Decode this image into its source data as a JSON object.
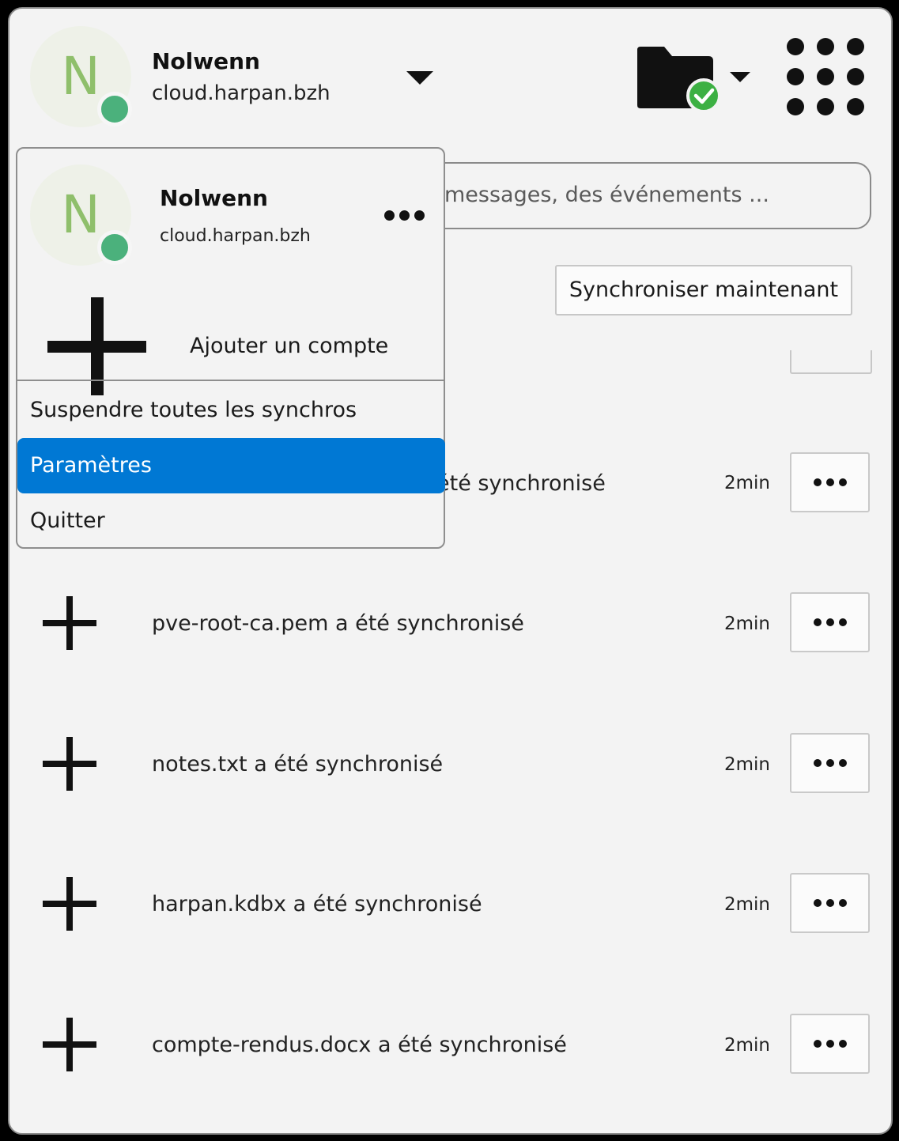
{
  "account": {
    "initial": "N",
    "name": "Nolwenn",
    "server": "cloud.harpan.bzh"
  },
  "search": {
    "placeholder": "messages, des événements ..."
  },
  "sync_button": "Synchroniser maintenant",
  "popup": {
    "account_name": "Nolwenn",
    "account_server": "cloud.harpan.bzh",
    "add_account": "Ajouter un compte",
    "menu": [
      "Suspendre toutes les synchros",
      "Paramètres",
      "Quitter"
    ]
  },
  "activity": [
    {
      "text": "été synchronisé",
      "time": "2min"
    },
    {
      "text": "pve-root-ca.pem a été synchronisé",
      "time": "2min"
    },
    {
      "text": "notes.txt a été synchronisé",
      "time": "2min"
    },
    {
      "text": "harpan.kdbx a été synchronisé",
      "time": "2min"
    },
    {
      "text": "compte-rendus.docx a été synchronisé",
      "time": "2min"
    }
  ],
  "colors": {
    "accent": "#0078d4",
    "online": "#4bb17c",
    "sync_ok": "#3cb043"
  },
  "icons": [
    "folder-sync-icon",
    "apps-grid-icon",
    "chevron-down-icon",
    "plus-icon",
    "more-icon"
  ]
}
